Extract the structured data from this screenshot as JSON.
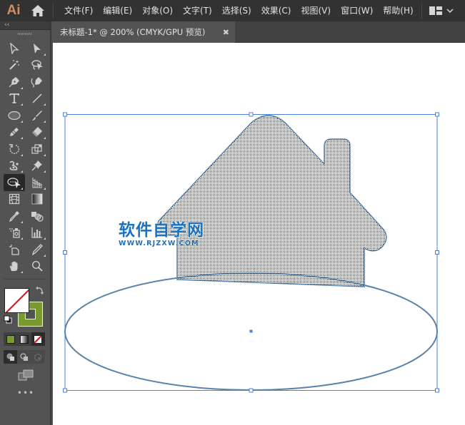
{
  "app": {
    "logo": "Ai",
    "home_icon": "home-icon"
  },
  "menu": {
    "items": [
      {
        "label": "文件(F)"
      },
      {
        "label": "编辑(E)"
      },
      {
        "label": "对象(O)"
      },
      {
        "label": "文字(T)"
      },
      {
        "label": "选择(S)"
      },
      {
        "label": "效果(C)"
      },
      {
        "label": "视图(V)"
      },
      {
        "label": "窗口(W)"
      },
      {
        "label": "帮助(H)"
      }
    ],
    "workspace_icon": "workspace-layout-icon"
  },
  "toolbar": {
    "collapse_label": "‹‹",
    "tools": [
      {
        "name": "selection-tool",
        "icon": "selection-arrow-icon"
      },
      {
        "name": "direct-selection-tool",
        "icon": "direct-selection-arrow-icon"
      },
      {
        "name": "magic-wand-tool",
        "icon": "magic-wand-icon"
      },
      {
        "name": "lasso-tool",
        "icon": "lasso-icon"
      },
      {
        "name": "pen-tool",
        "icon": "pen-icon"
      },
      {
        "name": "curvature-tool",
        "icon": "curvature-pen-icon"
      },
      {
        "name": "type-tool",
        "icon": "type-icon"
      },
      {
        "name": "line-segment-tool",
        "icon": "line-icon"
      },
      {
        "name": "ellipse-tool",
        "icon": "ellipse-icon"
      },
      {
        "name": "paintbrush-tool",
        "icon": "paintbrush-icon"
      },
      {
        "name": "shaper-tool",
        "icon": "pencil-icon"
      },
      {
        "name": "eraser-tool",
        "icon": "eraser-icon"
      },
      {
        "name": "rotate-tool",
        "icon": "rotate-icon"
      },
      {
        "name": "scale-tool",
        "icon": "scale-icon"
      },
      {
        "name": "puppet-warp-tool",
        "icon": "puppet-warp-icon"
      },
      {
        "name": "pin-tool",
        "icon": "pin-icon"
      },
      {
        "name": "shape-builder-tool",
        "icon": "shape-builder-icon",
        "active": true
      },
      {
        "name": "perspective-grid-tool",
        "icon": "perspective-grid-icon"
      },
      {
        "name": "mesh-tool",
        "icon": "mesh-icon"
      },
      {
        "name": "gradient-tool",
        "icon": "gradient-icon"
      },
      {
        "name": "eyedropper-tool",
        "icon": "eyedropper-icon"
      },
      {
        "name": "blend-tool",
        "icon": "blend-icon"
      },
      {
        "name": "symbol-sprayer-tool",
        "icon": "symbol-sprayer-icon"
      },
      {
        "name": "column-graph-tool",
        "icon": "column-graph-icon"
      },
      {
        "name": "artboard-tool",
        "icon": "artboard-icon"
      },
      {
        "name": "slice-tool",
        "icon": "slice-knife-icon"
      },
      {
        "name": "hand-tool",
        "icon": "hand-icon"
      },
      {
        "name": "zoom-tool",
        "icon": "magnifier-icon"
      }
    ],
    "fill": {
      "state": "none",
      "color": "#ffffff"
    },
    "stroke": {
      "color": "#7a9a2f"
    },
    "color_modes": [
      {
        "name": "color",
        "color": "#7a9a2f"
      },
      {
        "name": "gradient"
      },
      {
        "name": "none",
        "active": true
      }
    ],
    "draw_modes": [
      {
        "name": "draw-normal",
        "active": true
      },
      {
        "name": "draw-behind"
      },
      {
        "name": "draw-inside"
      }
    ],
    "more_label": "•••"
  },
  "document": {
    "tab_title": "未标题-1* @ 200% (CMYK/GPU 预览)",
    "close_label": "✖",
    "zoom": "200%",
    "color_mode": "CMYK/GPU 预览"
  },
  "canvas": {
    "selection_color": "#4a7fe0",
    "shape_stroke_color": "#5b82a8",
    "house_fill": "dotted-gray",
    "watermark": {
      "title": "软件自学网",
      "url": "WWW.RJZXW.COM",
      "color": "#1a72c4"
    }
  }
}
